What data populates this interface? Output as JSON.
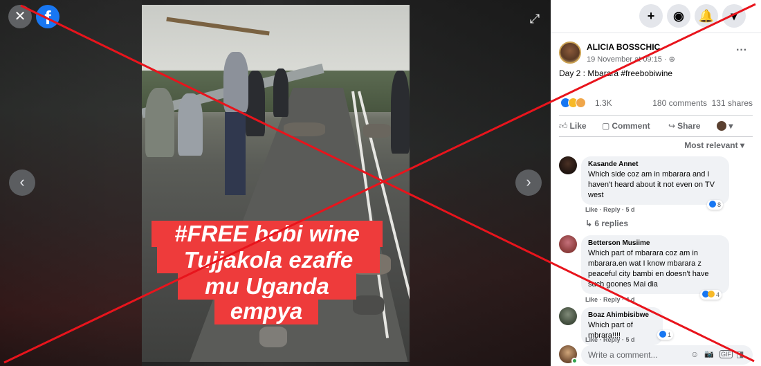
{
  "viewer": {
    "close_icon": "close-icon",
    "close_glyph": "✕",
    "logo_glyph": "f",
    "expand_glyph": "⤢",
    "prev_glyph": "‹",
    "next_glyph": "›"
  },
  "photo": {
    "caption_lines": [
      "#FREE bobi wine",
      "Tujjakola ezaffe",
      "mu Uganda",
      "empya"
    ],
    "caption_color": "#ee3b3b"
  },
  "topbar": {
    "buttons": [
      "+",
      "◉",
      "🔔",
      "▾"
    ]
  },
  "post": {
    "author": "ALICIA BOSSCHIC",
    "date": "19 November at 09:15 · ⊕",
    "text": "Day 2 : Mbarara #freebobiwine",
    "reaction_count": "1.3K",
    "comments": "180 comments",
    "shares": "131 shares",
    "actions": {
      "like": "Like",
      "comment": "Comment",
      "share": "Share"
    },
    "sort_label": "Most relevant ▾"
  },
  "comments": [
    {
      "name": "Kasande Annet",
      "text": "Which side coz am in mbarara and I haven't heard about it not even on TV west",
      "meta": "Like · Reply · 5 d",
      "likes": "8",
      "replies": "↳  6 replies"
    },
    {
      "name": "Betterson Musiime",
      "text": "Which part of mbarara coz am in mbarara.en wat I know mbarara z peaceful city bambi en doesn't have such goones Mai dia",
      "meta": "Like · Reply · 4 d",
      "likes": "4"
    },
    {
      "name": "Boaz Ahimbisibwe",
      "text": "Which part of mbrara!!!!",
      "meta": "Like · Reply · 5 d",
      "likes": "1"
    }
  ],
  "composer": {
    "placeholder": "Write a comment...",
    "tools": [
      "☺",
      "📷",
      "GIF",
      "◨"
    ]
  },
  "colors": {
    "facebook_blue": "#1877f2",
    "overlay_red": "#e8141c"
  }
}
